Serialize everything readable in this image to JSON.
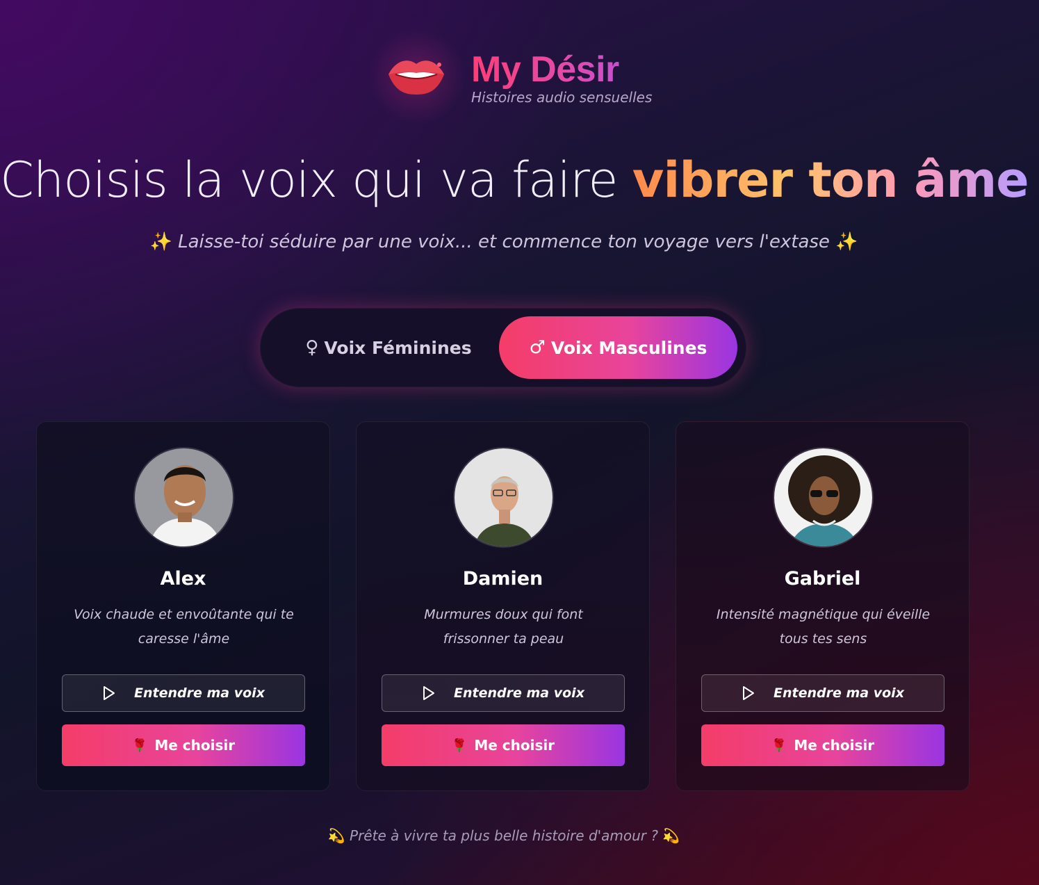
{
  "brand": {
    "title": "My Désir",
    "subtitle": "Histoires audio sensuelles",
    "logo_icon": "lips-icon"
  },
  "hero": {
    "title_plain": "Choisis la voix qui va faire ",
    "title_accent": "vibrer ton âme",
    "subtitle": "Laisse-toi séduire par une voix... et commence ton voyage vers l'extase",
    "sparkle": "✨"
  },
  "toggle": {
    "feminine": {
      "symbol": "♀",
      "label": "Voix Féminines",
      "active": false
    },
    "masculine": {
      "symbol": "♂",
      "label": "Voix Masculines",
      "active": true
    }
  },
  "voices": [
    {
      "name": "Alex",
      "description": "Voix chaude et envoûtante qui te caresse l'âme",
      "listen_label": "Entendre ma voix",
      "choose_label": "Me choisir",
      "choose_icon": "🌹"
    },
    {
      "name": "Damien",
      "description": "Murmures doux qui font frissonner ta peau",
      "listen_label": "Entendre ma voix",
      "choose_label": "Me choisir",
      "choose_icon": "🌹"
    },
    {
      "name": "Gabriel",
      "description": "Intensité magnétique qui éveille tous tes sens",
      "listen_label": "Entendre ma voix",
      "choose_label": "Me choisir",
      "choose_icon": "🌹"
    }
  ],
  "footer": {
    "text": "Prête à vivre ta plus belle histoire d'amour ?",
    "icon": "💫"
  },
  "colors": {
    "accent_start": "#f43d68",
    "accent_mid": "#e8449c",
    "accent_end": "#9a35e2"
  }
}
